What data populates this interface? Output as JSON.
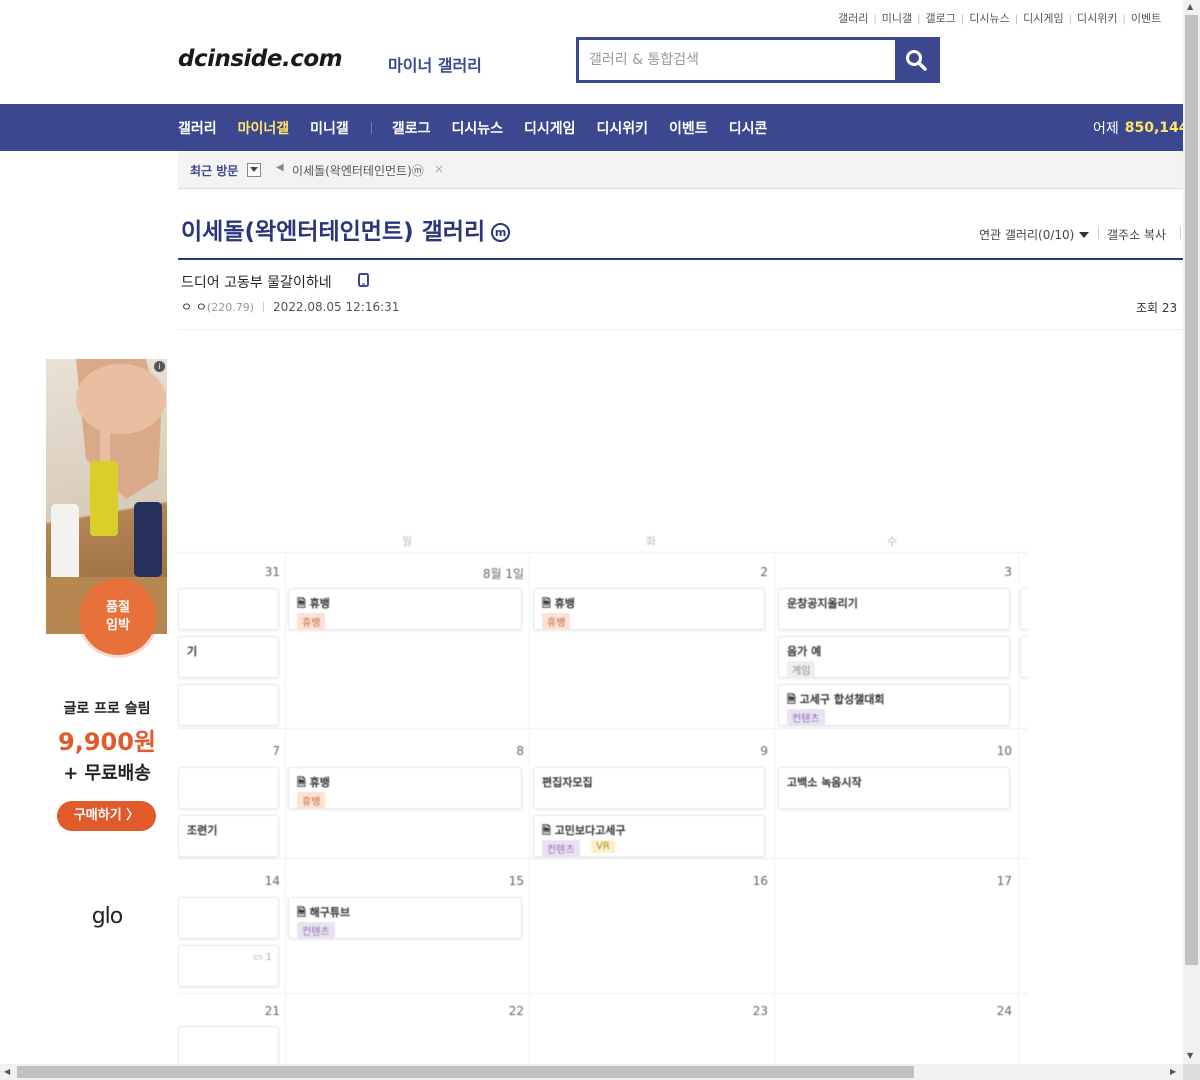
{
  "top_links": [
    "갤러리",
    "미니갤",
    "갤로그",
    "디시뉴스",
    "디시게임",
    "디시위키",
    "이벤트"
  ],
  "logo": {
    "main": "dcinside.com",
    "sub": "마이너 갤러리"
  },
  "search": {
    "placeholder": "갤러리 & 통합검색"
  },
  "gnb": {
    "items": [
      "갤러리",
      "마이너갤",
      "미니갤",
      "갤로그",
      "디시뉴스",
      "디시게임",
      "디시위키",
      "이벤트",
      "디시콘"
    ],
    "active_index": 1,
    "yesterday_label": "어제",
    "yesterday_count": "850,144"
  },
  "recent_visit": {
    "label": "최근 방문",
    "item": "이세돌(왁엔터테인먼트)ⓜ",
    "close": "×"
  },
  "gallery": {
    "title": "이세돌(왁엔터테인먼트) 갤러리",
    "badge": "m",
    "related_label": "연관 갤러리(0/10)",
    "copy_address": "갤주소 복사"
  },
  "post": {
    "title": "드디어 고동부 물갈이하네",
    "author": "ㅇ ㅇ",
    "ip": "(220.79)",
    "date": "2022.08.05 12:16:31",
    "views_label": "조회 23"
  },
  "ad": {
    "info": "i",
    "badge_line1": "품절",
    "badge_line2": "임박",
    "product": "글로 프로 슬림",
    "price": "9,900원",
    "shipping": "+ 무료배송",
    "buy": "구매하기 〉",
    "brand": "glo"
  },
  "calendar": {
    "weekdays": [
      "월",
      "화",
      "수"
    ],
    "dates": [
      {
        "label": "31"
      },
      {
        "label": "8월 1일"
      },
      {
        "label": "2"
      },
      {
        "label": "3"
      },
      {
        "label": "7"
      },
      {
        "label": "8"
      },
      {
        "label": "9"
      },
      {
        "label": "10"
      },
      {
        "label": "14"
      },
      {
        "label": "15"
      },
      {
        "label": "16"
      },
      {
        "label": "17"
      },
      {
        "label": "21"
      },
      {
        "label": "22"
      },
      {
        "label": "23"
      },
      {
        "label": "24"
      }
    ],
    "events": [
      {
        "title": "🗎 휴뱅",
        "tags": [
          {
            "text": "휴뱅",
            "color": "orange"
          }
        ]
      },
      {
        "title": "🗎 휴뱅",
        "tags": [
          {
            "text": "휴뱅",
            "color": "orange"
          }
        ]
      },
      {
        "title": "운창공지올리기",
        "tags": []
      },
      {
        "title": "기",
        "tags": []
      },
      {
        "title": "음가 예",
        "tags": [
          {
            "text": "게임",
            "color": "gray"
          }
        ]
      },
      {
        "title": "🗎 고세구 합성챌대회",
        "tags": [
          {
            "text": "컨텐츠",
            "color": "purple"
          }
        ]
      },
      {
        "title": "🗎 휴뱅",
        "tags": [
          {
            "text": "휴뱅",
            "color": "orange"
          }
        ]
      },
      {
        "title": "편집자모집",
        "tags": []
      },
      {
        "title": "고백소 녹음시작",
        "tags": []
      },
      {
        "title": "조련기",
        "tags": []
      },
      {
        "title": "🗎 고민보다고세구",
        "tags": [
          {
            "text": "컨텐츠",
            "color": "purple"
          },
          {
            "text": "VR",
            "color": "yellow"
          }
        ]
      },
      {
        "title": "🗎 해구튜브",
        "tags": [
          {
            "text": "컨텐츠",
            "color": "purple"
          }
        ]
      },
      {
        "title": "",
        "tags": [],
        "comment": "1"
      }
    ]
  },
  "colors": {
    "brand": "#3b4890",
    "title": "#29367c",
    "active_nav": "#ffe56a",
    "ad_accent": "#e05a2b"
  }
}
